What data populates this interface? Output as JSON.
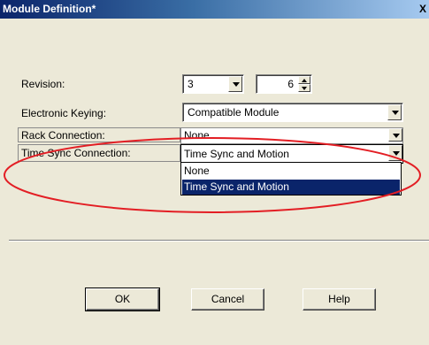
{
  "window": {
    "title": "Module Definition*",
    "close_glyph": "X"
  },
  "form": {
    "revision": {
      "label": "Revision:",
      "major": "3",
      "minor": "6"
    },
    "electronic_keying": {
      "label": "Electronic Keying:",
      "value": "Compatible Module"
    },
    "rack_connection": {
      "label": "Rack Connection:",
      "value": "None"
    },
    "time_sync_connection": {
      "label": "Time Sync Connection:",
      "value": "Time Sync and Motion",
      "options": [
        "None",
        "Time Sync and Motion"
      ],
      "selected_option": "Time Sync and Motion"
    }
  },
  "buttons": {
    "ok": "OK",
    "cancel": "Cancel",
    "help": "Help"
  },
  "annotation": {
    "highlight_color": "#e31e24"
  },
  "colors": {
    "dialog_bg": "#ece9d8",
    "selection_bg": "#0a246a",
    "title_bar": "#0a246a"
  },
  "icons": {
    "dropdown": "chevron-down-icon",
    "spin_up": "spin-up-icon",
    "spin_down": "spin-down-icon"
  }
}
